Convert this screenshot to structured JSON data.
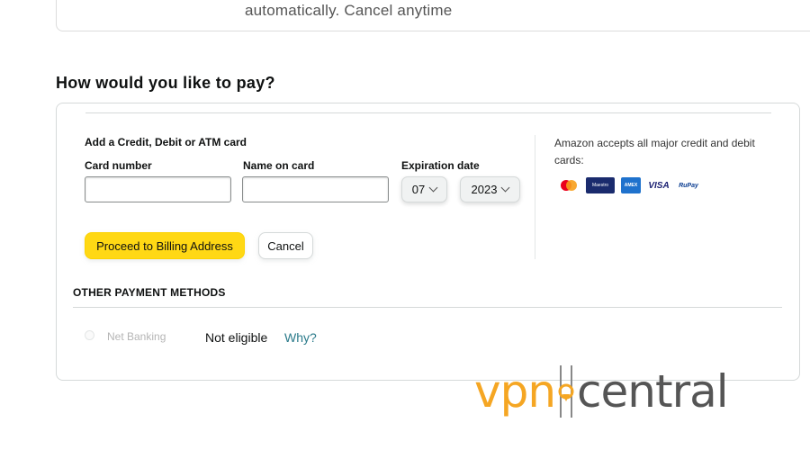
{
  "top_card": {
    "text": "automatically. Cancel anytime"
  },
  "payment": {
    "heading": "How would you like to pay?",
    "add_card_title": "Add a Credit, Debit or ATM card",
    "card_number_label": "Card number",
    "name_label": "Name on card",
    "expiration_label": "Expiration date",
    "month_value": "07",
    "year_value": "2023",
    "card_number_value": "",
    "name_value": "",
    "accepts_text": "Amazon accepts all major credit and debit cards:",
    "card_logos": [
      "mastercard-icon",
      "maestro-icon",
      "amex-icon",
      "visa-icon",
      "rupay-icon"
    ],
    "logo_text": {
      "maestro": "Maestro",
      "amex": "AMEX",
      "visa": "VISA",
      "rupay": "RuPay"
    },
    "proceed_button": "Proceed to Billing Address",
    "cancel_button": "Cancel"
  },
  "other_methods": {
    "heading": "OTHER PAYMENT METHODS",
    "net_banking_label": "Net Banking",
    "status": "Not eligible",
    "why_link": "Why?"
  },
  "watermark": {
    "part1": "vpn",
    "part2": "central"
  },
  "colors": {
    "primary_button": "#ffd814",
    "link": "#2a7a8a",
    "watermark_orange": "#f5a623",
    "watermark_gray": "#555555"
  }
}
